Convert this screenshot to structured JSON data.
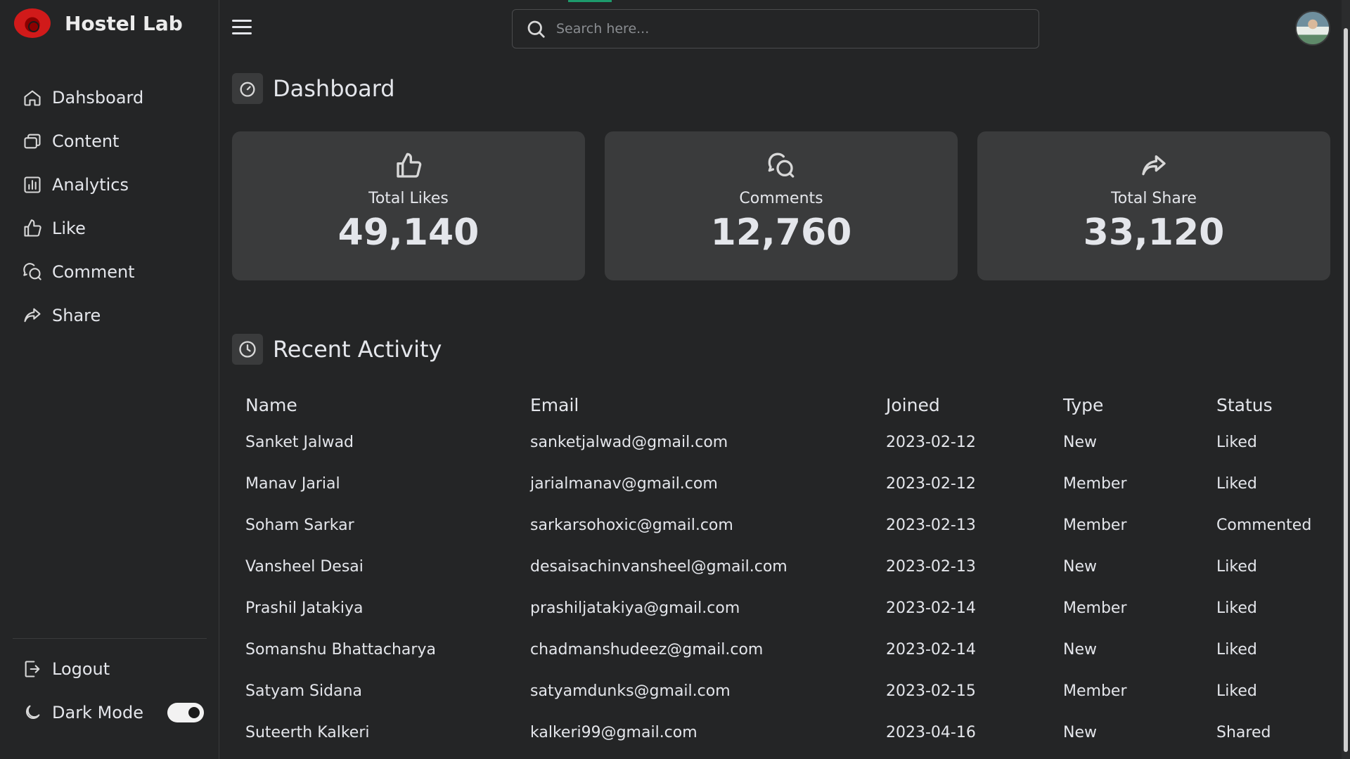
{
  "app": {
    "name": "Hostel Lab"
  },
  "sidebar": {
    "items": [
      {
        "label": "Dahsboard",
        "icon": "home-icon"
      },
      {
        "label": "Content",
        "icon": "files-icon"
      },
      {
        "label": "Analytics",
        "icon": "bar-chart-icon"
      },
      {
        "label": "Like",
        "icon": "thumbs-up-icon"
      },
      {
        "label": "Comment",
        "icon": "comment-icon"
      },
      {
        "label": "Share",
        "icon": "share-icon"
      }
    ],
    "logout_label": "Logout",
    "dark_mode_label": "Dark Mode",
    "dark_mode_on": true
  },
  "search": {
    "placeholder": "Search here..."
  },
  "dashboard": {
    "title": "Dashboard",
    "cards": [
      {
        "label": "Total Likes",
        "value": "49,140",
        "icon": "thumbs-up-icon"
      },
      {
        "label": "Comments",
        "value": "12,760",
        "icon": "comment-icon"
      },
      {
        "label": "Total Share",
        "value": "33,120",
        "icon": "share-icon"
      }
    ]
  },
  "activity": {
    "title": "Recent Activity",
    "columns": [
      "Name",
      "Email",
      "Joined",
      "Type",
      "Status"
    ],
    "rows": [
      [
        "Sanket Jalwad",
        "sanketjalwad@gmail.com",
        "2023-02-12",
        "New",
        "Liked"
      ],
      [
        "Manav Jarial",
        "jarialmanav@gmail.com",
        "2023-02-12",
        "Member",
        "Liked"
      ],
      [
        "Soham Sarkar",
        "sarkarsohoxic@gmail.com",
        "2023-02-13",
        "Member",
        "Commented"
      ],
      [
        "Vansheel Desai",
        "desaisachinvansheel@gmail.com",
        "2023-02-13",
        "New",
        "Liked"
      ],
      [
        "Prashil Jatakiya",
        "prashiljatakiya@gmail.com",
        "2023-02-14",
        "Member",
        "Liked"
      ],
      [
        "Somanshu Bhattacharya",
        "chadmanshudeez@gmail.com",
        "2023-02-14",
        "New",
        "Liked"
      ],
      [
        "Satyam Sidana",
        "satyamdunks@gmail.com",
        "2023-02-15",
        "Member",
        "Liked"
      ],
      [
        "Suteerth Kalkeri",
        "kalkeri99@gmail.com",
        "2023-04-16",
        "New",
        "Shared"
      ]
    ]
  },
  "colors": {
    "background": "#242526",
    "card": "#3a3b3c",
    "accent": "#1d9b6c",
    "text": "#e4e6eb"
  }
}
